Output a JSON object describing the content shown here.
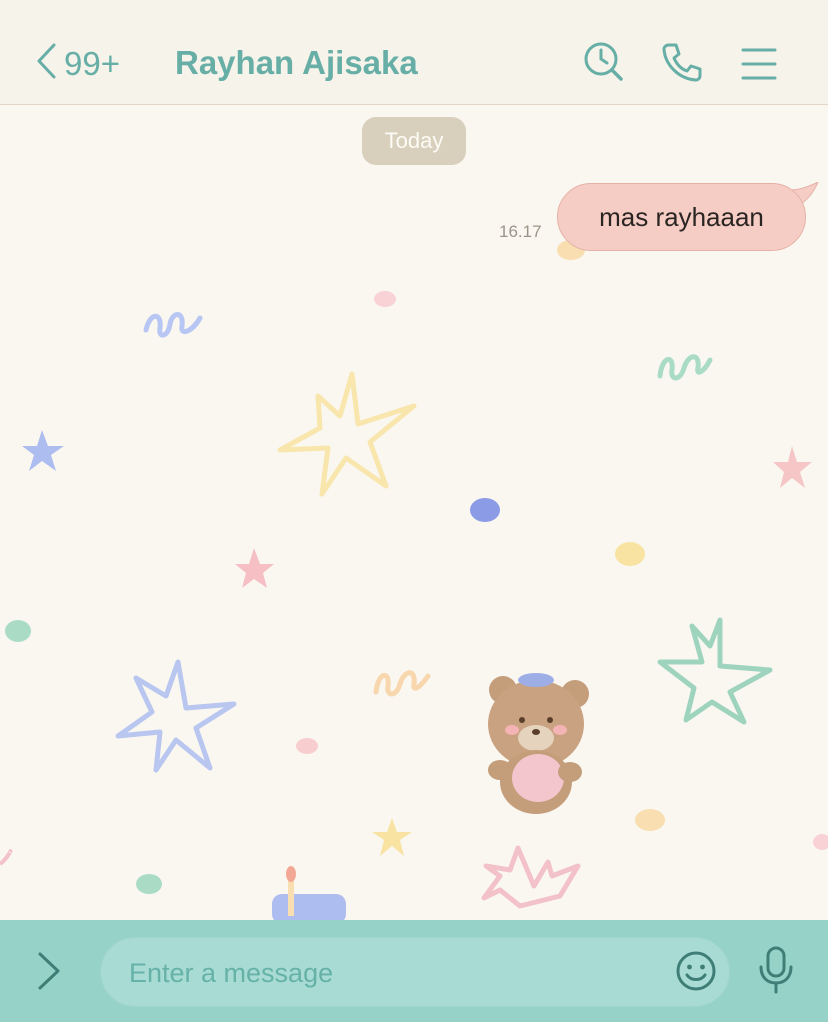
{
  "header": {
    "back_count": "99+",
    "contact_name": "Rayhan Ajisaka",
    "icons": [
      "chevron-left-icon",
      "search-clock-icon",
      "phone-icon",
      "menu-icon"
    ]
  },
  "chat": {
    "date_label": "Today",
    "messages": [
      {
        "direction": "outgoing",
        "text": "mas rayhaaan",
        "time": "16.17"
      }
    ]
  },
  "composer": {
    "placeholder": "Enter a message",
    "icons": [
      "chevron-right-icon",
      "smiley-icon",
      "microphone-icon"
    ]
  },
  "colors": {
    "accent": "#66aea6",
    "header_bg": "#f5f3ea",
    "chat_bg": "#faf7f1",
    "bubble_outgoing": "#f6cdc4",
    "footer_bg": "#96d2c8",
    "input_bg": "#a7dbd3",
    "date_pill": "#d8cfbc"
  }
}
